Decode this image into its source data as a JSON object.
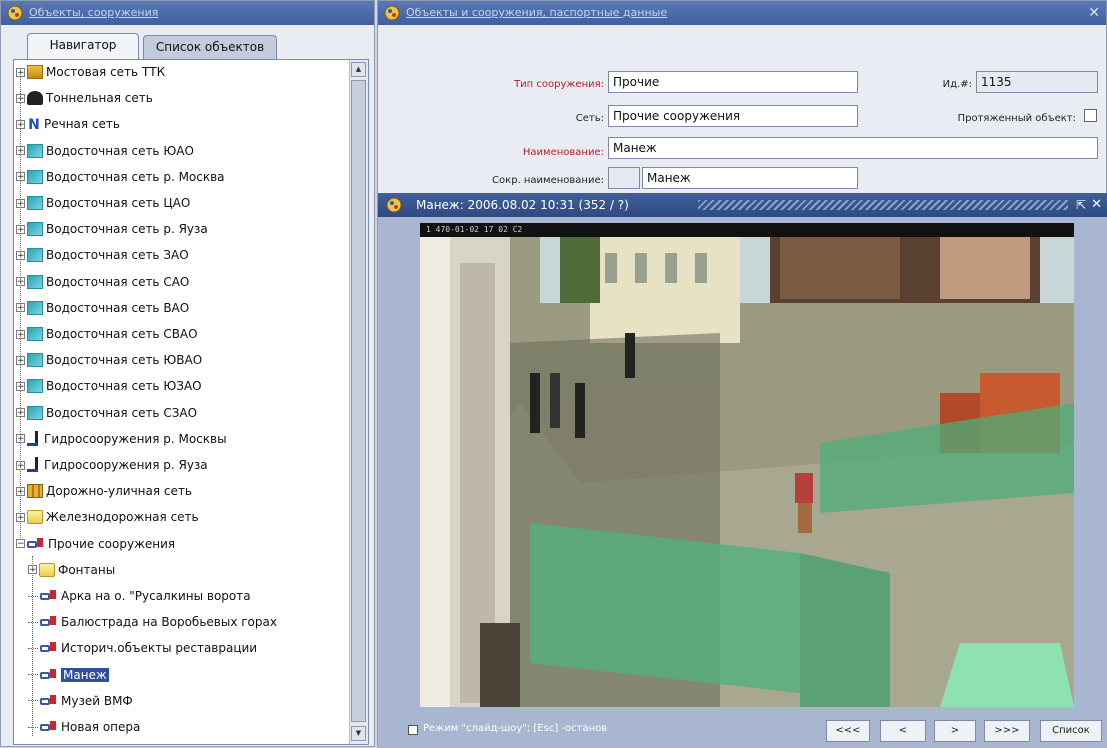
{
  "left_window": {
    "title": "Объекты, сооружения",
    "tabs": [
      {
        "label": "Навигатор",
        "active": true
      },
      {
        "label": "Список объектов",
        "active": false
      }
    ],
    "tree": [
      {
        "label": "Мостовая сеть ТТК",
        "icon": "bridge-icon"
      },
      {
        "label": "Тоннельная сеть",
        "icon": "tunnel-icon"
      },
      {
        "label": "Речная сеть",
        "icon": "river-icon"
      },
      {
        "label": "Водосточная сеть ЮАО",
        "icon": "water-network-icon"
      },
      {
        "label": "Водосточная сеть р. Москва",
        "icon": "water-network-icon"
      },
      {
        "label": "Водосточная сеть ЦАО",
        "icon": "water-network-icon"
      },
      {
        "label": "Водосточная сеть р. Яуза",
        "icon": "water-network-icon"
      },
      {
        "label": "Водосточная сеть ЗАО",
        "icon": "water-network-icon"
      },
      {
        "label": "Водосточная сеть САО",
        "icon": "water-network-icon"
      },
      {
        "label": "Водосточная сеть ВАО",
        "icon": "water-network-icon"
      },
      {
        "label": "Водосточная сеть СВАО",
        "icon": "water-network-icon"
      },
      {
        "label": "Водосточная сеть ЮВАО",
        "icon": "water-network-icon"
      },
      {
        "label": "Водосточная сеть ЮЗАО",
        "icon": "water-network-icon"
      },
      {
        "label": "Водосточная сеть СЗАО",
        "icon": "water-network-icon"
      },
      {
        "label": "Гидросооружения р. Москвы",
        "icon": "hydro-structure-icon"
      },
      {
        "label": "Гидросооружения р. Яуза",
        "icon": "hydro-structure-icon"
      },
      {
        "label": "Дорожно-уличная сеть",
        "icon": "road-network-icon"
      },
      {
        "label": "Железнодорожная сеть",
        "icon": "folder-icon"
      },
      {
        "label": "Прочие сооружения",
        "icon": "object-icon"
      },
      {
        "label": "Фонтаны",
        "icon": "folder-icon"
      },
      {
        "label": "Арка на о. \"Русалкины ворота",
        "icon": "object-icon"
      },
      {
        "label": "Балюстрада на Воробьевых горах",
        "icon": "object-icon"
      },
      {
        "label": "Историч.объекты реставрации",
        "icon": "object-icon"
      },
      {
        "label": "Манеж",
        "icon": "object-icon",
        "selected": true
      },
      {
        "label": "Музей ВМФ",
        "icon": "object-icon"
      },
      {
        "label": "Новая опера",
        "icon": "object-icon"
      }
    ]
  },
  "right_window": {
    "title": "Объекты и сооружения, паспортные данные",
    "form": {
      "type_label": "Тип сооружения:",
      "type_value": "Прочие",
      "network_label": "Сеть:",
      "network_value": "Прочие сооружения",
      "name_label": "Наименование:",
      "name_value": "Манеж",
      "short_name_label": "Сокр. наименование:",
      "short_name_value": "Манеж",
      "id_label": "Ид.#:",
      "id_value": "1135",
      "extended_label": "Протяженный объект:"
    },
    "viewer": {
      "title": "Манеж: 2006.08.02 10:31   (352 / ?)",
      "photo_stamp": "1 470-01-02  17 02 C2",
      "slideshow_label": "Режим \"слайд-шоу\";  [Esc] -останов",
      "buttons": {
        "first": "<<<",
        "prev": "<",
        "next": ">",
        "last": ">>>",
        "list": "Список"
      }
    }
  }
}
